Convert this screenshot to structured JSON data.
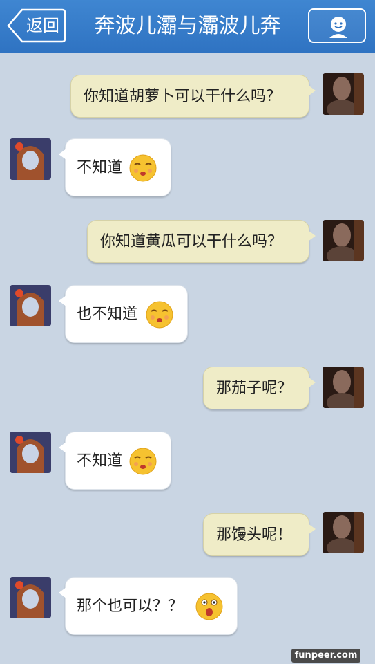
{
  "header": {
    "back_label": "返回",
    "title": "奔波儿灞与灞波儿奔",
    "profile_icon": "user-profile-icon"
  },
  "messages": [
    {
      "side": "right",
      "text": "你知道胡萝卜可以干什么吗？"
    },
    {
      "side": "left",
      "text": "不知道",
      "emoji": "shy-kiss-emoji"
    },
    {
      "side": "right",
      "text": "你知道黄瓜可以干什么吗？"
    },
    {
      "side": "left",
      "text": "也不知道",
      "emoji": "shy-kiss-emoji"
    },
    {
      "side": "right",
      "text": "那茄子呢？"
    },
    {
      "side": "left",
      "text": "不知道",
      "emoji": "shy-kiss-emoji"
    },
    {
      "side": "right",
      "text": "那馒头呢！"
    },
    {
      "side": "left",
      "text": "那个也可以？？",
      "emoji": "shocked-emoji"
    }
  ],
  "watermark": "funpeer.com"
}
